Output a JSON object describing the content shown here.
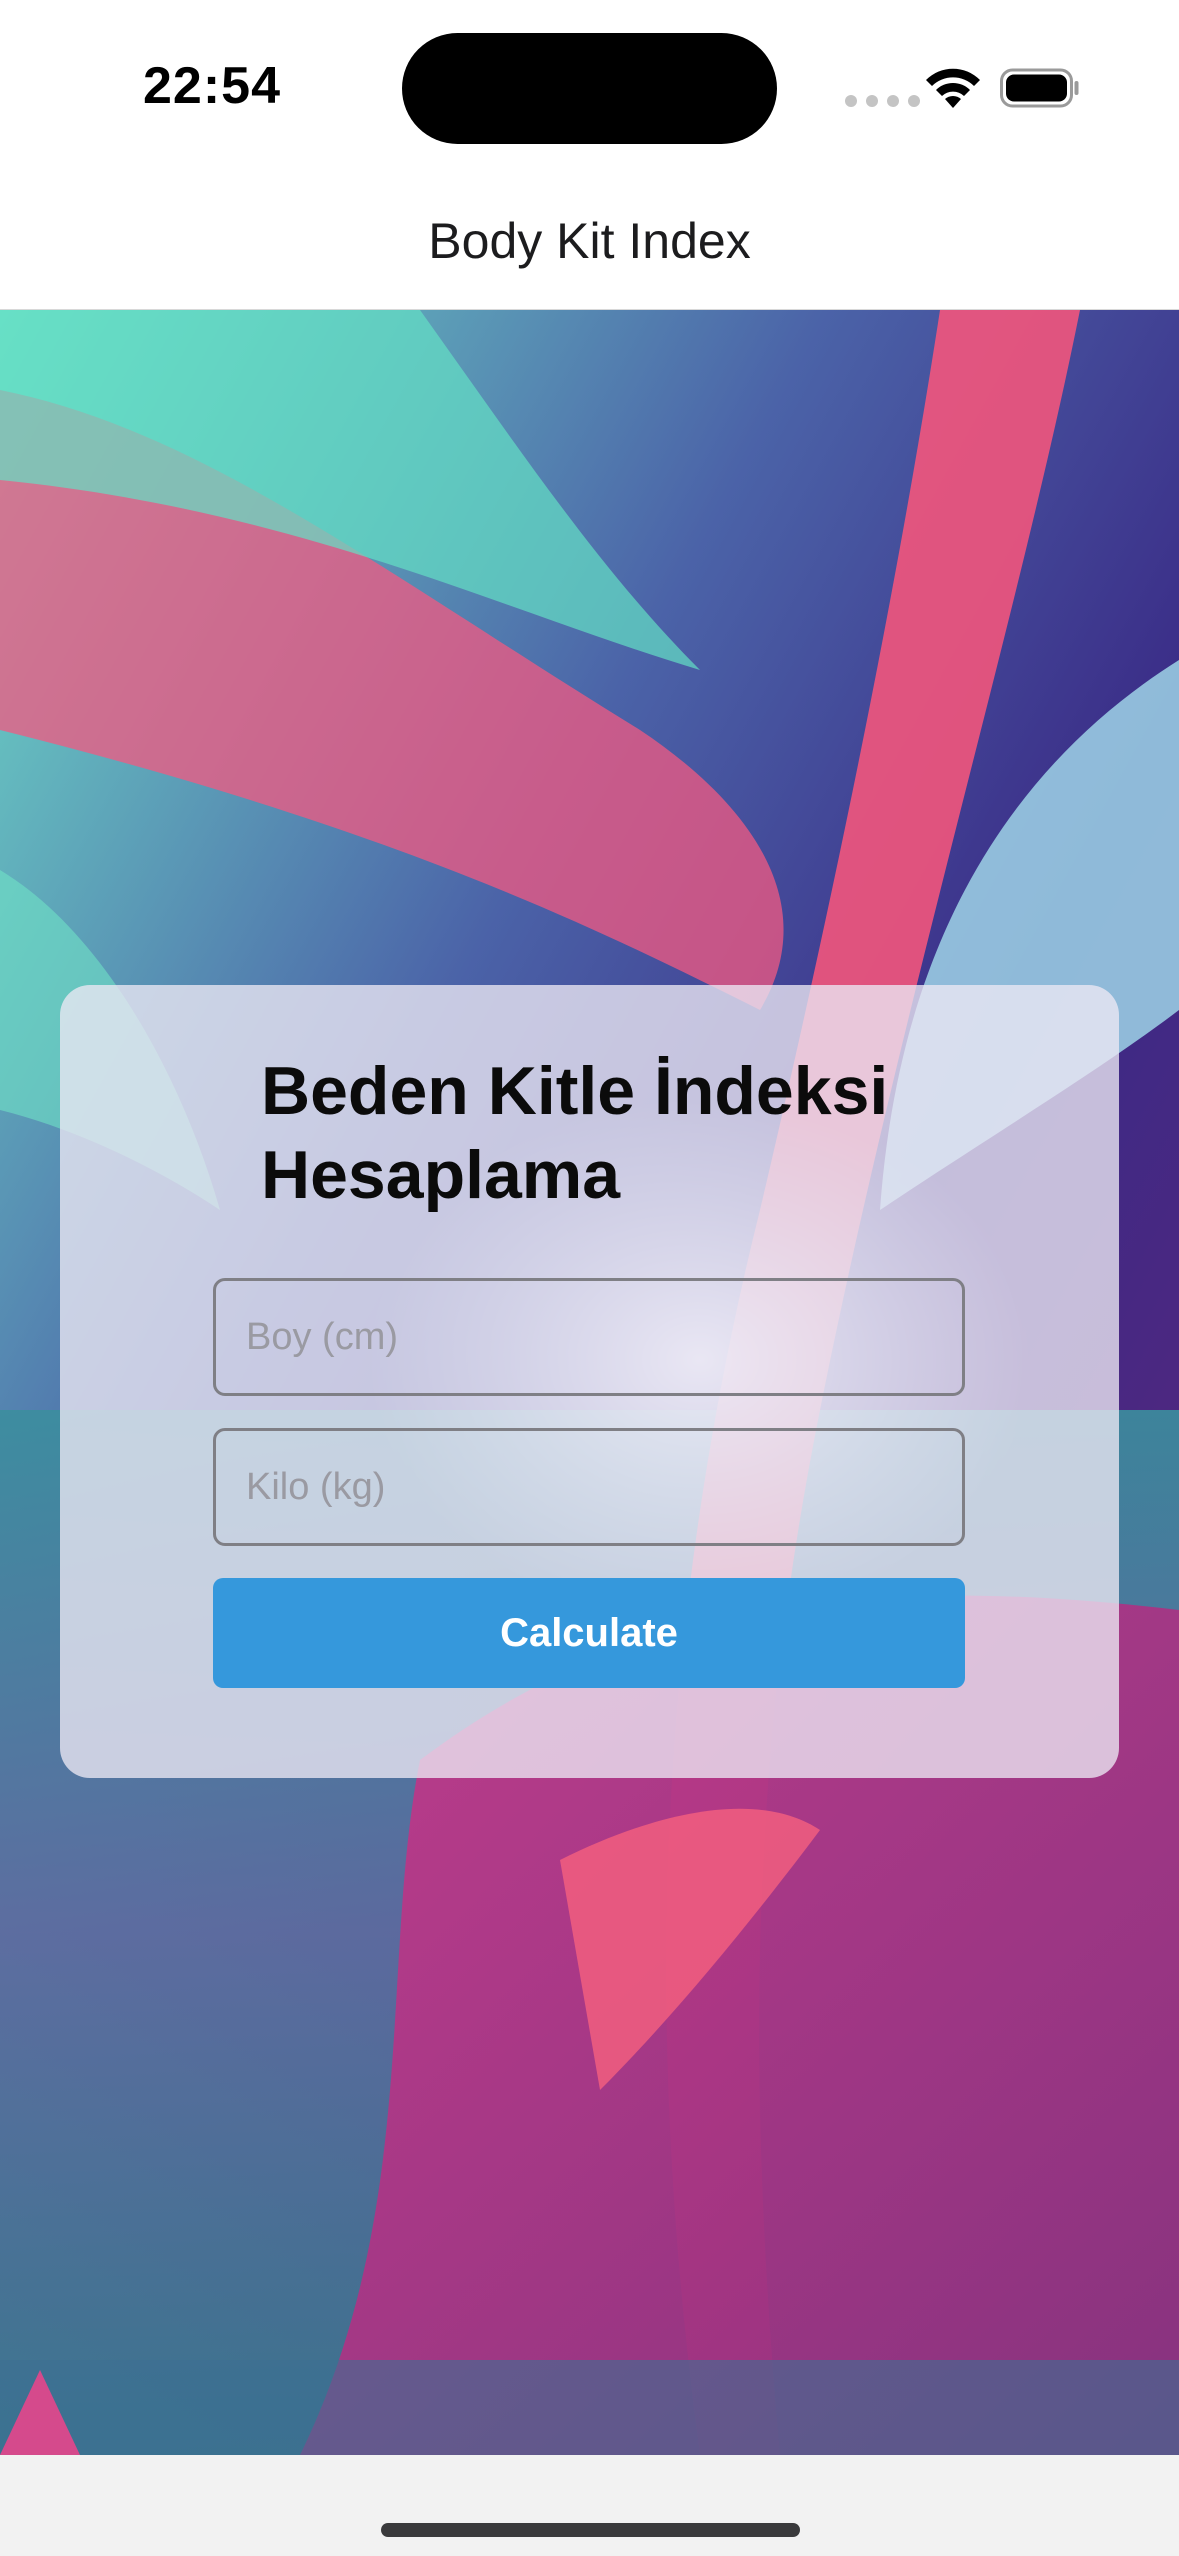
{
  "status_bar": {
    "time": "22:54",
    "icons": [
      "cellular-signal-icon",
      "wifi-icon",
      "battery-icon"
    ]
  },
  "header": {
    "title": "Body Kit Index"
  },
  "background": {
    "description_icon": "abstract-art-background",
    "colors": [
      "#5de3c6",
      "#f25a82",
      "#3a2a8c",
      "#8a2f8a",
      "#a8d8ea"
    ]
  },
  "form": {
    "title": "Beden Kitle İndeksi Hesaplama",
    "height_placeholder": "Boy (cm)",
    "weight_placeholder": "Kilo (kg)",
    "calculate_label": "Calculate",
    "accent_color": "#3598dc"
  }
}
